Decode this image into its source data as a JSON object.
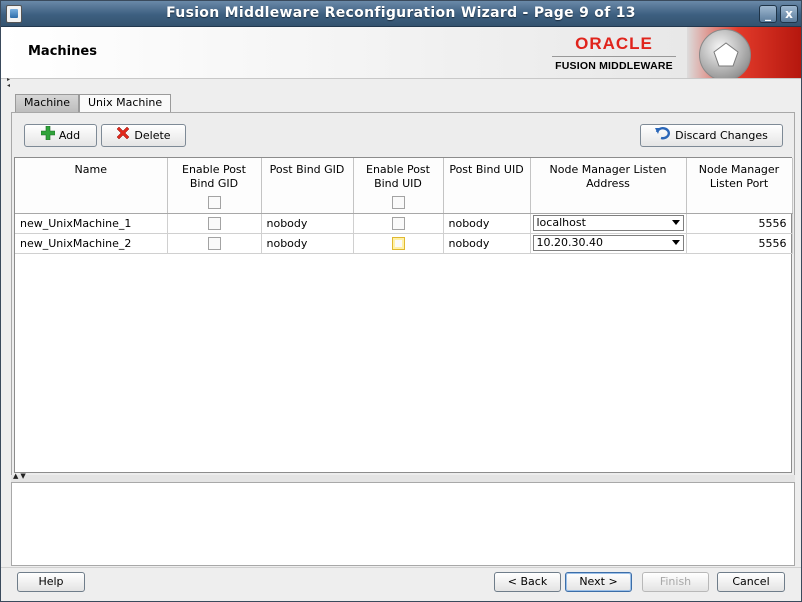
{
  "window": {
    "title": "Fusion Middleware Reconfiguration Wizard - Page 9 of 13",
    "minimize": "_",
    "close": "x"
  },
  "header": {
    "page_title": "Machines",
    "logo_word": "ORACLE",
    "logo_sub": "FUSION MIDDLEWARE"
  },
  "tabs": [
    {
      "label": "Machine"
    },
    {
      "label": "Unix Machine"
    }
  ],
  "toolbar": {
    "add_label": "Add",
    "delete_label": "Delete",
    "discard_label": "Discard Changes"
  },
  "table": {
    "columns": [
      "Name",
      "Enable Post Bind GID",
      "Post Bind GID",
      "Enable Post Bind UID",
      "Post Bind UID",
      "Node Manager Listen Address",
      "Node Manager Listen Port"
    ],
    "rows": [
      {
        "name": "new_UnixMachine_1",
        "enable_gid": false,
        "post_bind_gid": "nobody",
        "enable_uid": false,
        "post_bind_uid": "nobody",
        "listen_address": "localhost",
        "listen_port": "5556"
      },
      {
        "name": "new_UnixMachine_2",
        "enable_gid": false,
        "post_bind_gid": "nobody",
        "enable_uid": false,
        "post_bind_uid": "nobody",
        "listen_address": "10.20.30.40",
        "listen_port": "5556"
      }
    ]
  },
  "footer": {
    "help": "Help",
    "back": "< Back",
    "next": "Next >",
    "finish": "Finish",
    "cancel": "Cancel"
  }
}
